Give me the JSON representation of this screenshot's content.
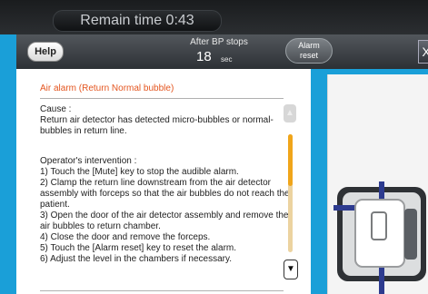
{
  "timer": {
    "remain_text": "Remain time 0:43"
  },
  "header": {
    "help_label": "Help",
    "bp_label": "After BP stops",
    "bp_value": "18",
    "bp_unit": "sec",
    "alarm_reset_line1": "Alarm",
    "alarm_reset_line2": "reset",
    "close_label": "X"
  },
  "alarm": {
    "title": "Air alarm (Return Normal bubble)",
    "cause_heading": "Cause :",
    "cause_text": "Return air detector has detected micro-bubbles or normal-bubbles in return line.",
    "intervention_heading": "Operator's intervention :",
    "steps": [
      "1) Touch the [Mute] key to stop the audible alarm.",
      "2) Clamp the return line downstream from the air detector assembly with forceps so that the air bubbles do not reach the patient.",
      "3) Open the door of the air detector assembly and remove the air bubbles to return chamber.",
      "4) Close the door and remove the forceps.",
      "5) Touch the [Alarm reset] key to reset the alarm.",
      "6) Adjust the level in the chambers if necessary."
    ]
  },
  "scroll": {
    "up_icon": "▲",
    "down_icon": "▼",
    "position": 0.0
  },
  "colors": {
    "background": "#1a9fd8",
    "title_color": "#e4551f",
    "scroll_thumb": "#f0a51a"
  }
}
